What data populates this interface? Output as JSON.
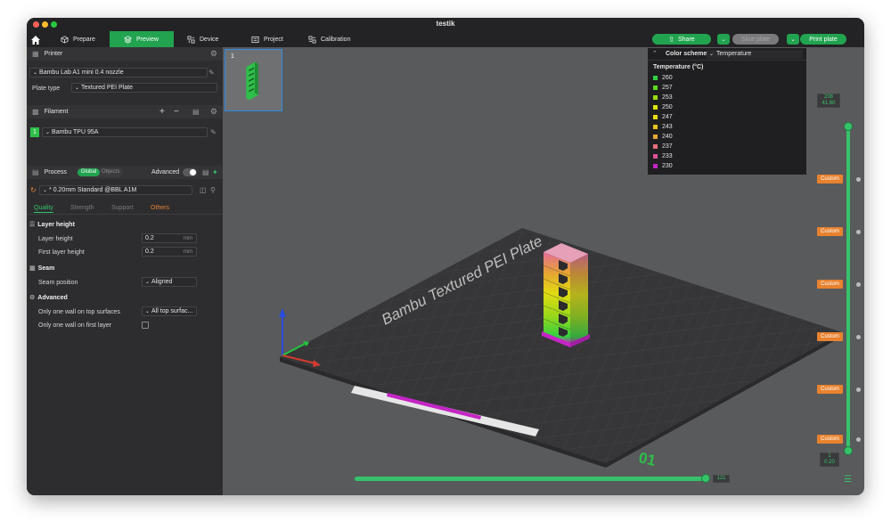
{
  "window": {
    "title": "testik"
  },
  "topbar": {
    "tabs": [
      {
        "label": "Prepare",
        "icon": "cube-icon"
      },
      {
        "label": "Preview",
        "icon": "layers-icon"
      },
      {
        "label": "Device",
        "icon": "device-icon"
      },
      {
        "label": "Project",
        "icon": "project-icon"
      },
      {
        "label": "Calibration",
        "icon": "calibration-icon"
      }
    ],
    "active_tab": "Preview",
    "share_label": "Share",
    "slice_label": "Slice plate",
    "print_label": "Print plate"
  },
  "sidebar": {
    "printer": {
      "section_label": "Printer",
      "printer_name": "Bambu Lab A1 mini 0.4 nozzle",
      "plate_type_label": "Plate type",
      "plate_type_value": "Textured PEI Plate"
    },
    "filament": {
      "section_label": "Filament",
      "slot": "1",
      "name": "Bambu TPU 95A",
      "color": "#2fbf4a"
    },
    "process": {
      "section_label": "Process",
      "global_label": "Global",
      "objects_label": "Objects",
      "advanced_label": "Advanced",
      "preset": "* 0.20mm Standard @BBL A1M"
    },
    "tabs": [
      "Quality",
      "Strength",
      "Support",
      "Others"
    ],
    "layer_height": {
      "heading": "Layer height",
      "layer_height_label": "Layer height",
      "layer_height_value": "0.2",
      "first_layer_height_label": "First layer height",
      "first_layer_height_value": "0.2",
      "unit": "mm"
    },
    "seam": {
      "heading": "Seam",
      "position_label": "Seam position",
      "position_value": "Aligned"
    },
    "advanced": {
      "heading": "Advanced",
      "top_wall_label": "Only one wall on top surfaces",
      "top_wall_value": "All top surfac...",
      "first_layer_wall_label": "Only one wall on first layer"
    }
  },
  "viewport": {
    "plate_thumb_number": "1",
    "plate_label": "Bambu Textured PEI Plate",
    "plate_number": "01",
    "color_scheme_label": "Color scheme",
    "color_scheme_value": "Temperature",
    "legend_title": "Temperature (°C)",
    "legend": [
      {
        "label": "260",
        "color": "#2ed13f"
      },
      {
        "label": "257",
        "color": "#5fd51f"
      },
      {
        "label": "253",
        "color": "#9bdc10"
      },
      {
        "label": "250",
        "color": "#d7e60c"
      },
      {
        "label": "247",
        "color": "#e8dc10"
      },
      {
        "label": "243",
        "color": "#e6c21a"
      },
      {
        "label": "240",
        "color": "#e3a636"
      },
      {
        "label": "237",
        "color": "#e5707a"
      },
      {
        "label": "233",
        "color": "#e0509a"
      },
      {
        "label": "230",
        "color": "#c525c5"
      }
    ],
    "custom_tags": [
      "Custom",
      "Custom",
      "Custom",
      "Custom",
      "Custom",
      "Custom"
    ],
    "layer_top_count": "208",
    "layer_top_height": "41.60",
    "layer_bottom_count": "1",
    "layer_bottom_height": "0.20",
    "move_slider_value": "121"
  }
}
